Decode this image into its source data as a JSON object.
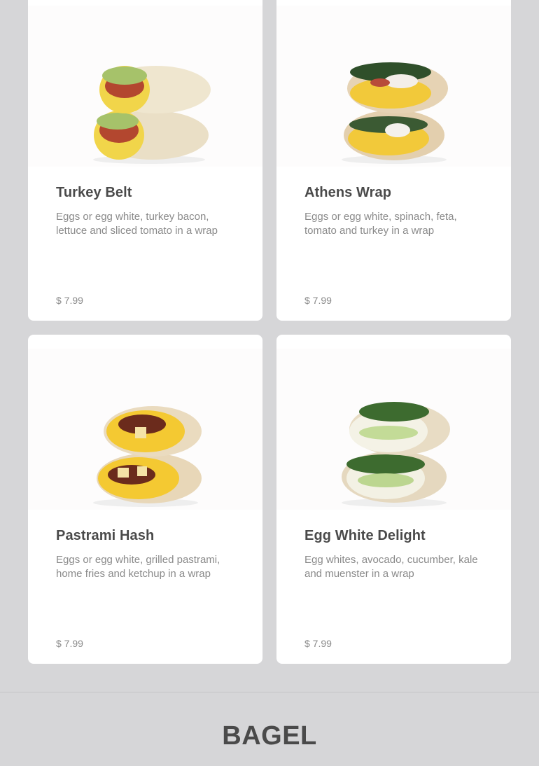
{
  "items": [
    {
      "name": "Turkey Belt",
      "description": "Eggs or egg white, turkey bacon, lettuce and sliced tomato in a wrap",
      "price": "$ 7.99",
      "image_icon": "wrap-image-turkey-belt"
    },
    {
      "name": "Athens Wrap",
      "description": "Eggs or egg white, spinach, feta, tomato and turkey in a wrap",
      "price": "$ 7.99",
      "image_icon": "wrap-image-athens"
    },
    {
      "name": "Pastrami Hash",
      "description": "Eggs or egg white, grilled pastrami, home fries and ketchup in a wrap",
      "price": "$ 7.99",
      "image_icon": "wrap-image-pastrami-hash"
    },
    {
      "name": "Egg White Delight",
      "description": "Egg whites, avocado, cucumber, kale and muenster in a wrap",
      "price": "$ 7.99",
      "image_icon": "wrap-image-egg-white-delight"
    }
  ],
  "next_section": {
    "title": "BAGEL"
  },
  "colors": {
    "background": "#d6d6d8",
    "card": "#ffffff",
    "title_text": "#4a4a4a",
    "muted_text": "#8a8a8a"
  }
}
